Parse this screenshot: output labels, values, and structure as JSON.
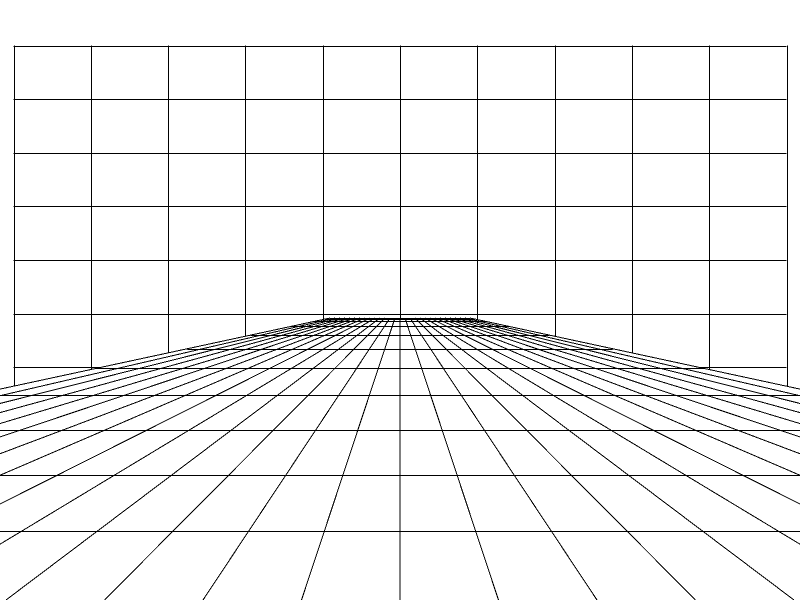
{
  "scene": {
    "background_color": "#ffffff",
    "line_color": "#000000",
    "wall_grid": {
      "columns": 10,
      "rows": 7
    },
    "floor_grid": {
      "converging_lines": 29,
      "depth_lines": 12
    }
  }
}
